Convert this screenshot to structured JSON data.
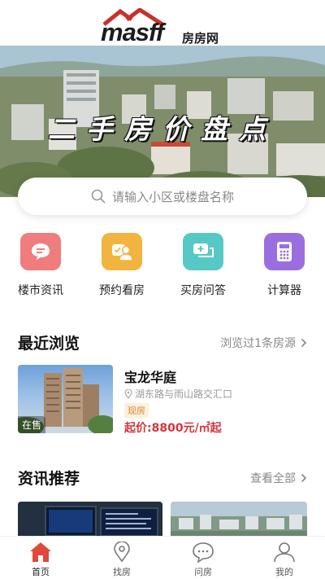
{
  "header": {
    "brand": "masff",
    "brand_cn": "房房网"
  },
  "banner": {
    "title": "二手房价盘点"
  },
  "search": {
    "placeholder": "请输入小区或楼盘名称"
  },
  "quick_links": [
    {
      "label": "楼市资讯",
      "icon": "message-bubble-icon",
      "color": "#ef7d7d"
    },
    {
      "label": "预约看房",
      "icon": "appointment-user-icon",
      "color": "#f1b43f"
    },
    {
      "label": "买房问答",
      "icon": "qa-chat-icon",
      "color": "#56c9c7"
    },
    {
      "label": "计算器",
      "icon": "calculator-icon",
      "color": "#9b6ee0"
    }
  ],
  "recent": {
    "title": "最近浏览",
    "more": "浏览过1条房源",
    "item": {
      "name": "宝龙华庭",
      "address": "湖东路与雨山路交汇口",
      "tag": "现房",
      "price": "起价:8800元/㎡起",
      "badge": "在售"
    }
  },
  "news": {
    "title": "资讯推荐",
    "more": "查看全部"
  },
  "tabs": [
    {
      "label": "首页",
      "icon": "home-icon",
      "active": true
    },
    {
      "label": "找房",
      "icon": "location-pin-icon",
      "active": false
    },
    {
      "label": "问房",
      "icon": "chat-bubble-icon",
      "active": false
    },
    {
      "label": "我的",
      "icon": "user-icon",
      "active": false
    }
  ],
  "colors": {
    "accent": "#d4353b",
    "price": "#d4353b",
    "tag": "#d88a2c",
    "tab_active": "#e0493a"
  }
}
